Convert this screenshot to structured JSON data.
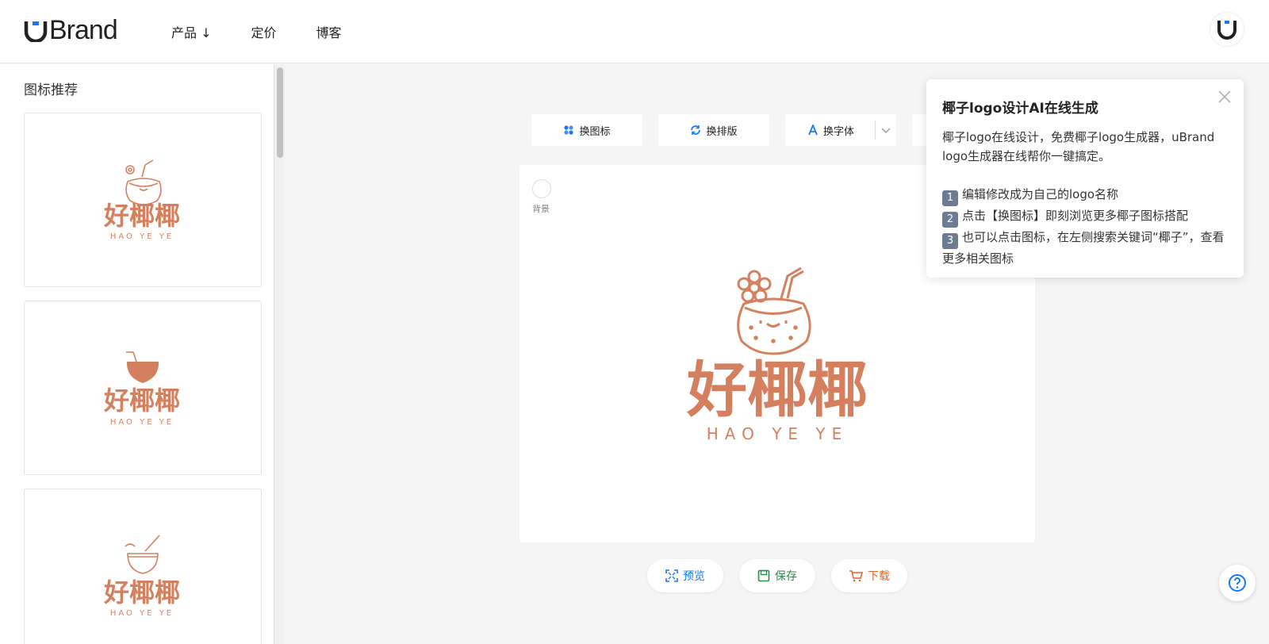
{
  "brand": {
    "name": "Brand",
    "accent": "#1677ff"
  },
  "nav": {
    "products": "产品 ↓",
    "pricing": "定价",
    "blog": "博客"
  },
  "sidebar": {
    "title": "图标推荐",
    "cards": [
      {
        "name_cn": "好椰椰",
        "name_en": "HAO YE YE",
        "icon": "coconut-flower-icon"
      },
      {
        "name_cn": "好椰椰",
        "name_en": "HAO YE YE",
        "icon": "coconut-solid-icon"
      },
      {
        "name_cn": "好椰椰",
        "name_en": "HAO YE YE",
        "icon": "coconut-cup-icon"
      }
    ]
  },
  "toolbar": {
    "change_icon": "换图标",
    "change_layout": "换排版",
    "change_font": "换字体"
  },
  "canvas": {
    "background_label": "背景",
    "logo_cn": "好椰椰",
    "logo_en": "HAO YE YE",
    "logo_color": "#d4805f"
  },
  "actions": {
    "preview": "预览",
    "save": "保存",
    "download": "下载"
  },
  "popup": {
    "title": "椰子logo设计AI在线生成",
    "intro": "椰子logo在线设计，免费椰子logo生成器，uBrand logo生成器在线帮你一键搞定。",
    "steps": [
      {
        "num": "1",
        "text": "编辑修改成为自己的logo名称"
      },
      {
        "num": "2",
        "text": "点击【换图标】即刻浏览更多椰子图标搭配"
      },
      {
        "num": "3",
        "text": "也可以点击图标，在左侧搜索关键词“椰子”，查看更多相关图标"
      }
    ]
  }
}
